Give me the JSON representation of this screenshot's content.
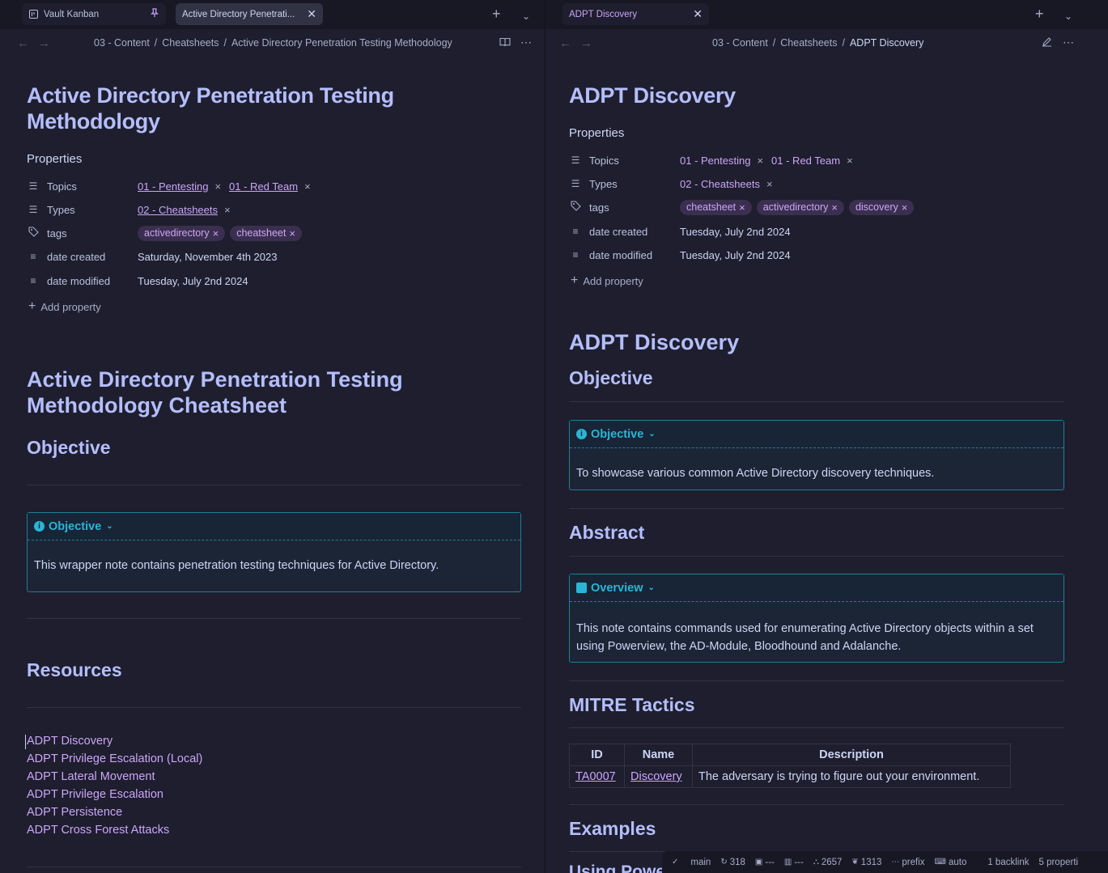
{
  "left": {
    "tabs": [
      {
        "label": "Vault Kanban",
        "icon": "kanban-icon",
        "pinned": true
      },
      {
        "label": "Active Directory Penetrati...",
        "icon": "",
        "close": "✕"
      }
    ],
    "breadcrumb": [
      "03 - Content",
      "Cheatsheets",
      "Active Directory Penetration Testing Methodology"
    ],
    "title": "Active Directory Penetration Testing Methodology",
    "properties_label": "Properties",
    "props": {
      "topics_key": "Topics",
      "topics": [
        "01 - Pentesting",
        "01 - Red Team"
      ],
      "types_key": "Types",
      "types": [
        "02 - Cheatsheets"
      ],
      "tags_key": "tags",
      "tags": [
        "activedirectory",
        "cheatsheet"
      ],
      "created_key": "date created",
      "created": "Saturday, November 4th 2023",
      "modified_key": "date modified",
      "modified": "Tuesday, July 2nd 2024"
    },
    "add_property": "Add property",
    "h1": "Active Directory Penetration Testing Methodology Cheatsheet",
    "objective_h": "Objective",
    "callout_title": "Objective",
    "callout_body": "This wrapper note contains penetration testing techniques for Active Directory.",
    "resources_h": "Resources",
    "resources": [
      "ADPT Discovery",
      "ADPT Privilege Escalation (Local)",
      "ADPT Lateral Movement",
      "ADPT Privilege Escalation",
      "ADPT Persistence",
      "ADPT Cross Forest Attacks"
    ]
  },
  "right": {
    "tab": {
      "label": "ADPT Discovery",
      "close": "✕"
    },
    "breadcrumb": [
      "03 - Content",
      "Cheatsheets",
      "ADPT Discovery"
    ],
    "title": "ADPT Discovery",
    "properties_label": "Properties",
    "props": {
      "topics_key": "Topics",
      "topics": [
        "01 - Pentesting",
        "01 - Red Team"
      ],
      "types_key": "Types",
      "types": [
        "02 - Cheatsheets"
      ],
      "tags_key": "tags",
      "tags": [
        "cheatsheet",
        "activedirectory",
        "discovery"
      ],
      "created_key": "date created",
      "created": "Tuesday, July 2nd 2024",
      "modified_key": "date modified",
      "modified": "Tuesday, July 2nd 2024"
    },
    "add_property": "Add property",
    "h1": "ADPT Discovery",
    "objective_h": "Objective",
    "objective_callout_title": "Objective",
    "objective_callout_body": "To showcase various common Active Directory discovery techniques.",
    "abstract_h": "Abstract",
    "overview_callout_title": "Overview",
    "overview_callout_body": "This note contains commands used for enumerating Active Directory objects within a set using Powerview, the AD-Module, Bloodhound and Adalanche.",
    "mitre_h": "MITRE Tactics",
    "table": {
      "headers": [
        "ID",
        "Name",
        "Description"
      ],
      "rows": [
        [
          "TA0007",
          "Discovery",
          "The adversary is trying to figure out your environment."
        ]
      ]
    },
    "examples_h": "Examples",
    "cut_h": "Using Powe"
  },
  "statusbar": {
    "branch": "main",
    "words": "318",
    "s1": "---",
    "s2": "---",
    "chars": "2657",
    "lines": "1313",
    "prefix": "prefix",
    "auto": "auto",
    "backlinks": "1 backlink",
    "properties": "5 properti"
  },
  "colors": {
    "accent": "#cba6f7",
    "heading": "#b4befe",
    "callout": "#29b6d6",
    "bg": "#1e1e2e"
  }
}
